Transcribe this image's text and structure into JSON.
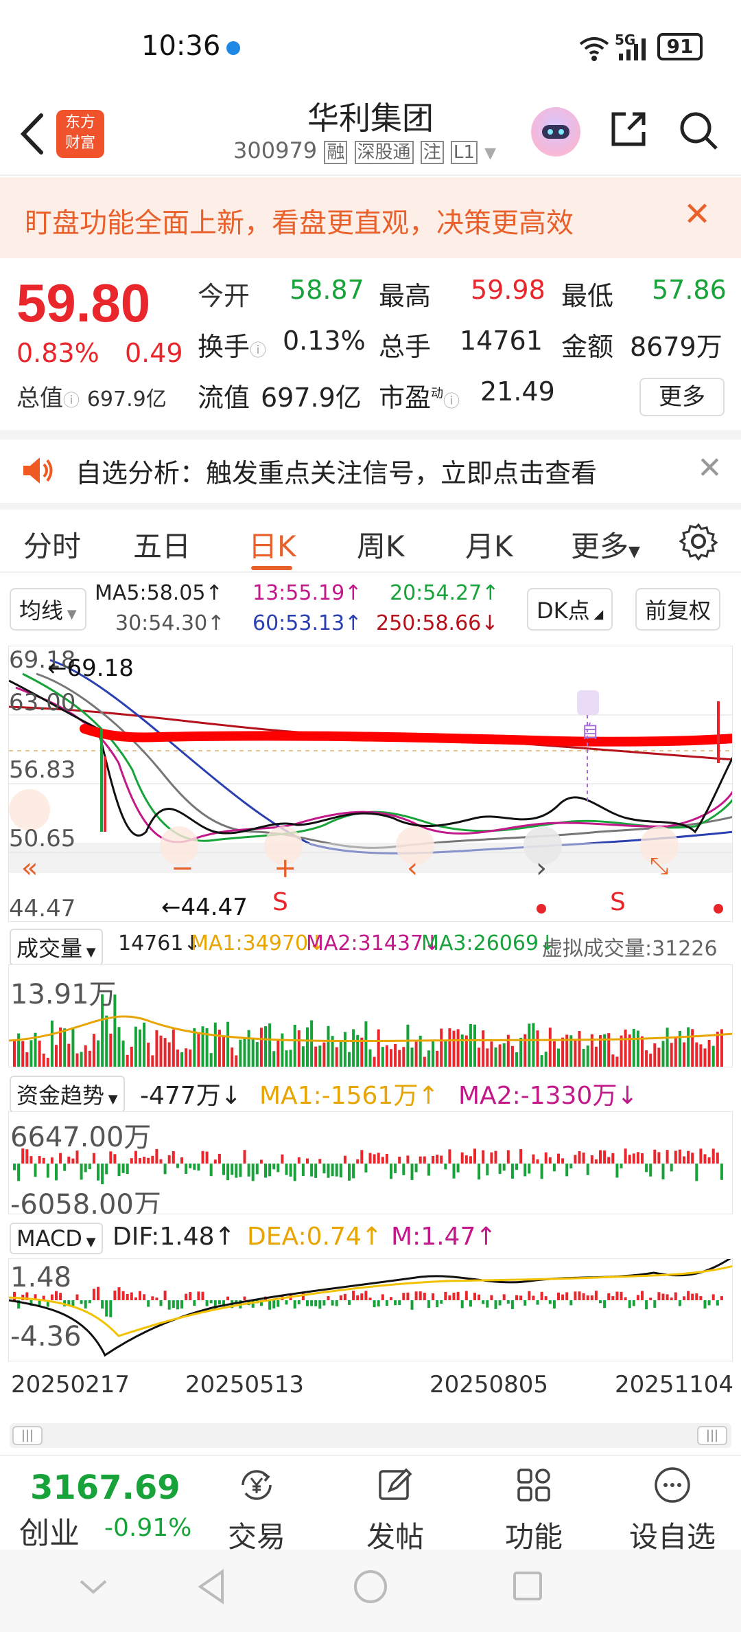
{
  "status_bar": {
    "time": "10:36",
    "network": "5G",
    "battery": "91"
  },
  "header": {
    "logo_text": "东方财富",
    "stock_name": "华利集团",
    "stock_code": "300979",
    "tags": [
      "融",
      "深股通",
      "注",
      "L1"
    ]
  },
  "banner": {
    "text": "盯盘功能全面上新，看盘更直观，决策更高效"
  },
  "quote": {
    "price": "59.80",
    "change_pct": "0.83%",
    "change": "0.49",
    "total_value_label": "总值",
    "total_value": "697.9亿",
    "rows": [
      [
        {
          "label": "今开",
          "value": "58.87",
          "color": "green"
        },
        {
          "label": "最高",
          "value": "59.98",
          "color": "red"
        },
        {
          "label": "最低",
          "value": "57.86",
          "color": "green"
        }
      ],
      [
        {
          "label": "换手",
          "value": "0.13%",
          "color": "dark"
        },
        {
          "label": "总手",
          "value": "14761",
          "color": "dark"
        },
        {
          "label": "金额",
          "value": "8679万",
          "color": "dark"
        }
      ],
      [
        {
          "label": "流值",
          "value": "697.9亿",
          "color": "dark"
        },
        {
          "label": "市盈",
          "value": "21.49",
          "color": "dark"
        }
      ]
    ],
    "more_label": "更多",
    "pe_sup": "动"
  },
  "alert": {
    "text": "自选分析：触发重点关注信号，立即点击查看"
  },
  "tabs": {
    "items": [
      "分时",
      "五日",
      "日K",
      "周K",
      "月K",
      "更多"
    ],
    "active": "日K"
  },
  "ma_bar": {
    "mode": "均线",
    "items": [
      {
        "text": "MA5:58.05↑",
        "color": "#222222"
      },
      {
        "text": "13:55.19↑",
        "color": "#c2188a"
      },
      {
        "text": "20:54.27↑",
        "color": "#18a33a"
      },
      {
        "text": "30:54.30↑",
        "color": "#555555"
      },
      {
        "text": "60:53.13↑",
        "color": "#2a3fb0"
      },
      {
        "text": "250:58.66↓",
        "color": "#b5121b"
      }
    ],
    "dk_label": "DK点",
    "adjust_label": "前复权"
  },
  "kline": {
    "y_labels": [
      "69.18",
      "63.00",
      "56.83",
      "50.65",
      "44.47"
    ],
    "high_mark": "69.18",
    "low_mark": "44.47",
    "signal_mark": "自",
    "s_marks": [
      "S",
      "S"
    ]
  },
  "volume": {
    "selector": "成交量",
    "value": "14761↓",
    "ma1": "MA1:34970↓",
    "ma2": "MA2:31437↓",
    "ma3": "MA3:26069↓",
    "virtual": "虚拟成交量:31226",
    "y_label": "13.91万"
  },
  "fund": {
    "selector": "资金趋势",
    "value": "-477万↓",
    "ma1": "MA1:-1561万↑",
    "ma2": "MA2:-1330万↓",
    "y_top": "6647.00万",
    "y_bottom": "-6058.00万"
  },
  "macd": {
    "selector": "MACD",
    "dif": "DIF:1.48↑",
    "dea": "DEA:0.74↑",
    "m": "M:1.47↑",
    "y_top": "1.48",
    "y_bottom": "-4.36"
  },
  "dates": [
    "20250217",
    "20250513",
    "20250805",
    "20251104"
  ],
  "bottom_nav": {
    "index_value": "3167.69",
    "index_name": "创业",
    "index_pct": "-0.91%",
    "items": [
      {
        "label": "交易",
        "icon": "yen-exchange-icon"
      },
      {
        "label": "发帖",
        "icon": "edit-icon"
      },
      {
        "label": "功能",
        "icon": "grid-icon"
      },
      {
        "label": "设自选",
        "icon": "more-circle-icon"
      }
    ]
  }
}
